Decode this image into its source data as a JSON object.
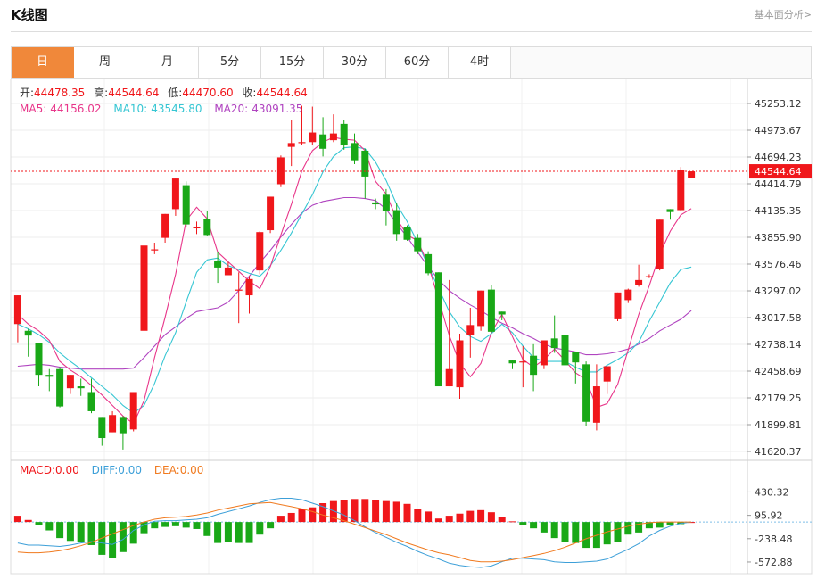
{
  "header": {
    "title": "K线图",
    "analysis_link": "基本面分析>"
  },
  "tabs": [
    {
      "label": "日",
      "active": true
    },
    {
      "label": "周"
    },
    {
      "label": "月"
    },
    {
      "label": "5分"
    },
    {
      "label": "15分"
    },
    {
      "label": "30分"
    },
    {
      "label": "60分"
    },
    {
      "label": "4时"
    }
  ],
  "ohlc_info": {
    "open_label": "开:",
    "open": "44478.35",
    "high_label": "高:",
    "high": "44544.64",
    "low_label": "低:",
    "low": "44470.60",
    "close_label": "收:",
    "close": "44544.64"
  },
  "ma_info": {
    "ma5_label": "MA5:",
    "ma5": "44156.02",
    "ma10_label": "MA10:",
    "ma10": "43545.80",
    "ma20_label": "MA20:",
    "ma20": "43091.35"
  },
  "macd_info": {
    "macd_label": "MACD:",
    "macd": "0.00",
    "diff_label": "DIFF:",
    "diff": "0.00",
    "dea_label": "DEA:",
    "dea": "0.00"
  },
  "colors": {
    "up": "#f0171b",
    "down": "#19a817",
    "ma5": "#e8368a",
    "ma10": "#36c6d3",
    "ma20": "#b044c0",
    "diff": "#3c9fd8",
    "dea": "#f07a1f",
    "active_tab": "#f0883a"
  },
  "chart_data": [
    {
      "type": "candlestick",
      "ylim": [
        41620.37,
        45253.12
      ],
      "price_ticks": [
        "45253.12",
        "44973.67",
        "44694.23",
        "44414.79",
        "44135.35",
        "43855.90",
        "43576.46",
        "43297.02",
        "43017.58",
        "42738.14",
        "42458.69",
        "42179.25",
        "41899.81",
        "41620.37"
      ],
      "last_price": "44544.64",
      "candles": [
        {
          "o": 42950,
          "h": 43200,
          "l": 42760,
          "c": 43250
        },
        {
          "o": 42880,
          "h": 42900,
          "l": 42610,
          "c": 42830
        },
        {
          "o": 42750,
          "h": 42750,
          "l": 42300,
          "c": 42420
        },
        {
          "o": 42420,
          "h": 42480,
          "l": 42250,
          "c": 42400
        },
        {
          "o": 42480,
          "h": 42500,
          "l": 42080,
          "c": 42090
        },
        {
          "o": 42280,
          "h": 42420,
          "l": 42220,
          "c": 42420
        },
        {
          "o": 42300,
          "h": 42380,
          "l": 42200,
          "c": 42280
        },
        {
          "o": 42240,
          "h": 42380,
          "l": 42020,
          "c": 42040
        },
        {
          "o": 41980,
          "h": 41980,
          "l": 41680,
          "c": 41760
        },
        {
          "o": 41820,
          "h": 42040,
          "l": 41860,
          "c": 42000
        },
        {
          "o": 41980,
          "h": 41990,
          "l": 41640,
          "c": 41810
        },
        {
          "o": 41850,
          "h": 42230,
          "l": 41830,
          "c": 42240
        },
        {
          "o": 42880,
          "h": 43770,
          "l": 42860,
          "c": 43770
        },
        {
          "o": 43730,
          "h": 43800,
          "l": 43680,
          "c": 43730
        },
        {
          "o": 43850,
          "h": 44080,
          "l": 43800,
          "c": 44100
        },
        {
          "o": 44150,
          "h": 44470,
          "l": 44080,
          "c": 44470
        },
        {
          "o": 44400,
          "h": 44440,
          "l": 43960,
          "c": 43990
        },
        {
          "o": 43960,
          "h": 44020,
          "l": 43890,
          "c": 43960
        },
        {
          "o": 44050,
          "h": 44130,
          "l": 43870,
          "c": 43880
        },
        {
          "o": 43610,
          "h": 43700,
          "l": 43380,
          "c": 43540
        },
        {
          "o": 43460,
          "h": 43600,
          "l": 43490,
          "c": 43540
        },
        {
          "o": 43300,
          "h": 43490,
          "l": 42960,
          "c": 43310
        },
        {
          "o": 43250,
          "h": 43450,
          "l": 43060,
          "c": 43420
        },
        {
          "o": 43510,
          "h": 43920,
          "l": 43470,
          "c": 43910
        },
        {
          "o": 43930,
          "h": 44250,
          "l": 43900,
          "c": 44280
        },
        {
          "o": 44410,
          "h": 44710,
          "l": 44380,
          "c": 44690
        },
        {
          "o": 44800,
          "h": 45080,
          "l": 44600,
          "c": 44840
        },
        {
          "o": 44850,
          "h": 45230,
          "l": 44820,
          "c": 44850
        },
        {
          "o": 44850,
          "h": 45220,
          "l": 44820,
          "c": 44950
        },
        {
          "o": 44930,
          "h": 45110,
          "l": 44700,
          "c": 44780
        },
        {
          "o": 44870,
          "h": 45140,
          "l": 44850,
          "c": 44940
        },
        {
          "o": 45040,
          "h": 45080,
          "l": 44770,
          "c": 44820
        },
        {
          "o": 44840,
          "h": 44940,
          "l": 44620,
          "c": 44660
        },
        {
          "o": 44760,
          "h": 44780,
          "l": 44260,
          "c": 44490
        },
        {
          "o": 44220,
          "h": 44260,
          "l": 44150,
          "c": 44200
        },
        {
          "o": 44300,
          "h": 44360,
          "l": 43980,
          "c": 44130
        },
        {
          "o": 44140,
          "h": 44210,
          "l": 43820,
          "c": 43890
        },
        {
          "o": 43960,
          "h": 43980,
          "l": 43820,
          "c": 43830
        },
        {
          "o": 43850,
          "h": 43890,
          "l": 43680,
          "c": 43710
        },
        {
          "o": 43680,
          "h": 43710,
          "l": 43460,
          "c": 43480
        },
        {
          "o": 43490,
          "h": 43480,
          "l": 42300,
          "c": 42300
        },
        {
          "o": 42300,
          "h": 43410,
          "l": 42320,
          "c": 42480
        },
        {
          "o": 42290,
          "h": 42850,
          "l": 42170,
          "c": 42780
        },
        {
          "o": 42840,
          "h": 43120,
          "l": 42600,
          "c": 42940
        },
        {
          "o": 42930,
          "h": 43290,
          "l": 42880,
          "c": 43300
        },
        {
          "o": 43310,
          "h": 43360,
          "l": 42860,
          "c": 42870
        },
        {
          "o": 43080,
          "h": 43080,
          "l": 42990,
          "c": 43050
        },
        {
          "o": 42570,
          "h": 42580,
          "l": 42480,
          "c": 42540
        },
        {
          "o": 42550,
          "h": 42720,
          "l": 42290,
          "c": 42560
        },
        {
          "o": 42620,
          "h": 42740,
          "l": 42250,
          "c": 42420
        },
        {
          "o": 42520,
          "h": 42780,
          "l": 42480,
          "c": 42780
        },
        {
          "o": 42800,
          "h": 43040,
          "l": 42650,
          "c": 42700
        },
        {
          "o": 42840,
          "h": 42910,
          "l": 42450,
          "c": 42520
        },
        {
          "o": 42660,
          "h": 42620,
          "l": 42330,
          "c": 42550
        },
        {
          "o": 42530,
          "h": 42560,
          "l": 41890,
          "c": 41930
        },
        {
          "o": 41920,
          "h": 42530,
          "l": 41840,
          "c": 42300
        },
        {
          "o": 42350,
          "h": 42510,
          "l": 42220,
          "c": 42510
        },
        {
          "o": 43000,
          "h": 43270,
          "l": 42980,
          "c": 43280
        },
        {
          "o": 43200,
          "h": 43320,
          "l": 43170,
          "c": 43310
        },
        {
          "o": 43360,
          "h": 43570,
          "l": 43340,
          "c": 43410
        },
        {
          "o": 43440,
          "h": 43470,
          "l": 43430,
          "c": 43450
        },
        {
          "o": 43530,
          "h": 44040,
          "l": 43510,
          "c": 44040
        },
        {
          "o": 44150,
          "h": 44120,
          "l": 44040,
          "c": 44120
        },
        {
          "o": 44140,
          "h": 44590,
          "l": 44130,
          "c": 44560
        },
        {
          "o": 44478.35,
          "h": 44544.64,
          "l": 44470.6,
          "c": 44544.64
        }
      ],
      "ma5": [
        43050,
        42950,
        42880,
        42780,
        42560,
        42470,
        42400,
        42310,
        42210,
        42100,
        41990,
        41910,
        42150,
        42600,
        43020,
        43470,
        44030,
        44170,
        44050,
        43700,
        43600,
        43500,
        43400,
        43320,
        43550,
        43880,
        44200,
        44550,
        44760,
        44850,
        44900,
        44880,
        44870,
        44760,
        44440,
        44310,
        44050,
        43880,
        43820,
        43570,
        43200,
        42830,
        42540,
        42400,
        42540,
        42860,
        43050,
        42820,
        42580,
        42500,
        42580,
        42690,
        42570,
        42440,
        42370,
        42080,
        42120,
        42320,
        42680,
        43050,
        43350,
        43680,
        43920,
        44090,
        44156.02
      ],
      "ma10": [
        42950,
        42900,
        42840,
        42760,
        42650,
        42560,
        42480,
        42390,
        42300,
        42210,
        42100,
        42020,
        42100,
        42330,
        42620,
        42860,
        43180,
        43490,
        43620,
        43640,
        43560,
        43520,
        43480,
        43450,
        43560,
        43720,
        43900,
        44100,
        44300,
        44540,
        44700,
        44790,
        44800,
        44780,
        44640,
        44450,
        44200,
        44020,
        43800,
        43550,
        43320,
        43080,
        42920,
        42820,
        42770,
        42850,
        42950,
        42860,
        42720,
        42600,
        42560,
        42560,
        42560,
        42500,
        42450,
        42450,
        42520,
        42580,
        42650,
        42760,
        42980,
        43180,
        43380,
        43520,
        43545.8
      ],
      "ma20": [
        42510,
        42520,
        42530,
        42520,
        42500,
        42490,
        42480,
        42480,
        42480,
        42480,
        42480,
        42490,
        42600,
        42720,
        42840,
        42920,
        43010,
        43080,
        43100,
        43120,
        43180,
        43300,
        43450,
        43590,
        43720,
        43860,
        43990,
        44110,
        44190,
        44230,
        44250,
        44270,
        44270,
        44260,
        44240,
        44150,
        44000,
        43860,
        43700,
        43550,
        43410,
        43300,
        43220,
        43150,
        43090,
        43020,
        42960,
        42910,
        42850,
        42800,
        42740,
        42700,
        42680,
        42660,
        42630,
        42630,
        42640,
        42660,
        42690,
        42740,
        42800,
        42880,
        42940,
        43000,
        43091.35
      ]
    },
    {
      "type": "macd",
      "ylim": [
        -650,
        500
      ],
      "ticks": [
        "430.32",
        "95.92",
        "-238.48",
        "-572.88"
      ],
      "macd": [
        90,
        30,
        -40,
        -120,
        -230,
        -270,
        -290,
        -330,
        -470,
        -520,
        -430,
        -310,
        -160,
        -90,
        -70,
        -60,
        -80,
        -100,
        -200,
        -300,
        -280,
        -300,
        -300,
        -180,
        -90,
        90,
        130,
        190,
        210,
        270,
        300,
        320,
        330,
        330,
        310,
        300,
        290,
        260,
        190,
        150,
        50,
        90,
        120,
        160,
        170,
        140,
        70,
        10,
        -40,
        -90,
        -150,
        -230,
        -280,
        -300,
        -370,
        -370,
        -320,
        -290,
        -180,
        -150,
        -90,
        -80,
        -50,
        -30,
        0
      ],
      "diff": [
        -300,
        -330,
        -330,
        -340,
        -350,
        -330,
        -300,
        -280,
        -300,
        -320,
        -250,
        -120,
        -40,
        10,
        20,
        20,
        30,
        40,
        60,
        110,
        150,
        190,
        230,
        280,
        320,
        340,
        340,
        320,
        270,
        220,
        160,
        100,
        20,
        -70,
        -150,
        -220,
        -290,
        -350,
        -420,
        -480,
        -530,
        -590,
        -620,
        -640,
        -650,
        -630,
        -570,
        -520,
        -520,
        -530,
        -540,
        -570,
        -580,
        -580,
        -570,
        -560,
        -530,
        -460,
        -390,
        -310,
        -200,
        -120,
        -60,
        -20,
        0
      ],
      "dea": [
        -430,
        -440,
        -440,
        -430,
        -410,
        -380,
        -340,
        -290,
        -230,
        -170,
        -110,
        -50,
        0,
        40,
        60,
        70,
        80,
        100,
        130,
        170,
        200,
        230,
        260,
        270,
        280,
        250,
        220,
        190,
        150,
        100,
        60,
        20,
        -30,
        -80,
        -130,
        -180,
        -240,
        -300,
        -350,
        -400,
        -440,
        -470,
        -510,
        -550,
        -570,
        -570,
        -560,
        -540,
        -510,
        -480,
        -450,
        -410,
        -360,
        -300,
        -240,
        -190,
        -140,
        -100,
        -60,
        -30,
        -10,
        0,
        0,
        0,
        0
      ]
    }
  ]
}
